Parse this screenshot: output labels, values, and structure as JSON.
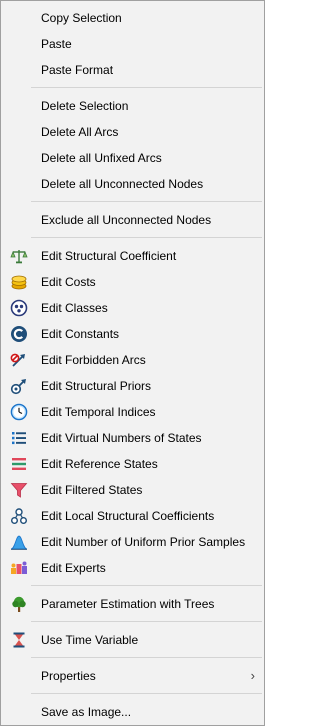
{
  "menu": {
    "copy_selection": "Copy Selection",
    "paste": "Paste",
    "paste_format": "Paste Format",
    "delete_selection": "Delete Selection",
    "delete_all_arcs": "Delete All Arcs",
    "delete_unfixed_arcs": "Delete all Unfixed Arcs",
    "delete_unconnected_nodes": "Delete all Unconnected Nodes",
    "exclude_unconnected_nodes": "Exclude all Unconnected Nodes",
    "edit_structural_coefficient": "Edit Structural Coefficient",
    "edit_costs": "Edit Costs",
    "edit_classes": "Edit Classes",
    "edit_constants": "Edit Constants",
    "edit_forbidden_arcs": "Edit Forbidden Arcs",
    "edit_structural_priors": "Edit Structural Priors",
    "edit_temporal_indices": "Edit Temporal Indices",
    "edit_virtual_numbers": "Edit Virtual Numbers of States",
    "edit_reference_states": "Edit Reference States",
    "edit_filtered_states": "Edit Filtered States",
    "edit_local_structural_coefficients": "Edit Local Structural Coefficients",
    "edit_uniform_prior_samples": "Edit Number of Uniform Prior Samples",
    "edit_experts": "Edit Experts",
    "parameter_estimation_trees": "Parameter Estimation with Trees",
    "use_time_variable": "Use Time Variable",
    "properties": "Properties",
    "properties_arrow": "›",
    "save_as_image": "Save as Image..."
  },
  "icons": {
    "scale": "scale-icon",
    "coins": "coins-icon",
    "classes": "classes-icon",
    "constants": "constants-icon",
    "forbidden": "forbidden-arc-icon",
    "priors": "structural-priors-icon",
    "clock": "clock-icon",
    "list": "numbered-list-icon",
    "reference": "reference-states-icon",
    "filter": "filter-icon",
    "local": "local-coefficients-icon",
    "distribution": "distribution-icon",
    "experts": "experts-icon",
    "tree": "tree-icon",
    "hourglass": "hourglass-icon"
  },
  "colors": {
    "menu_bg": "#f2f2f2",
    "border": "#a0a0a0",
    "separator": "#d4d4d4"
  }
}
